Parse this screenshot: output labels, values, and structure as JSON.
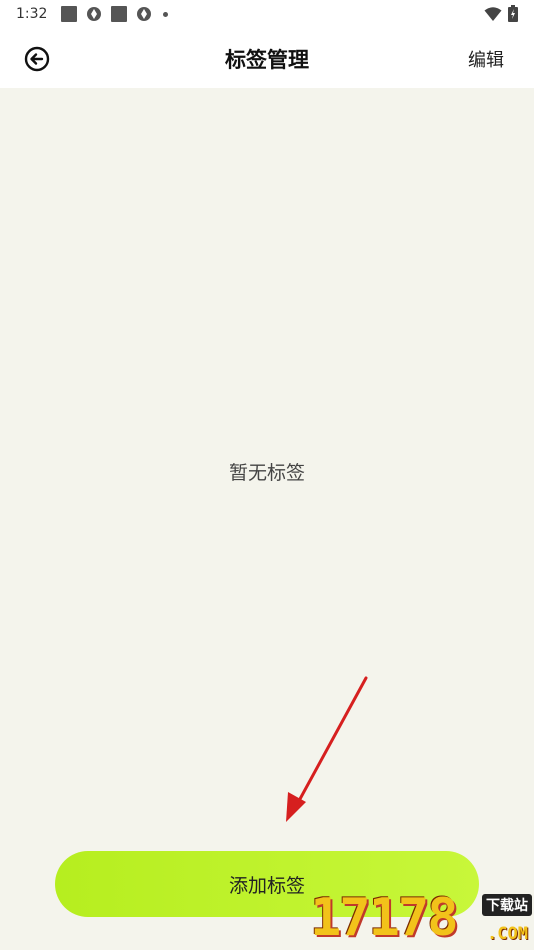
{
  "status_bar": {
    "time": "1:32",
    "left_icons": [
      "square-notification-icon",
      "aperture-icon",
      "square-notification-icon",
      "aperture-icon",
      "dot-icon"
    ],
    "right_icons": [
      "wifi-icon",
      "battery-icon"
    ]
  },
  "header": {
    "title": "标签管理",
    "edit_label": "编辑",
    "back_icon": "back-circle-arrow-icon"
  },
  "main": {
    "empty_text": "暂无标签",
    "add_button_label": "添加标签"
  },
  "colors": {
    "background": "#f4f4ec",
    "accent": "#bdf02a",
    "annotation_arrow": "#d61f1f"
  },
  "watermark": {
    "number": "17178",
    "badge": "下载站",
    "suffix": ".COM"
  }
}
